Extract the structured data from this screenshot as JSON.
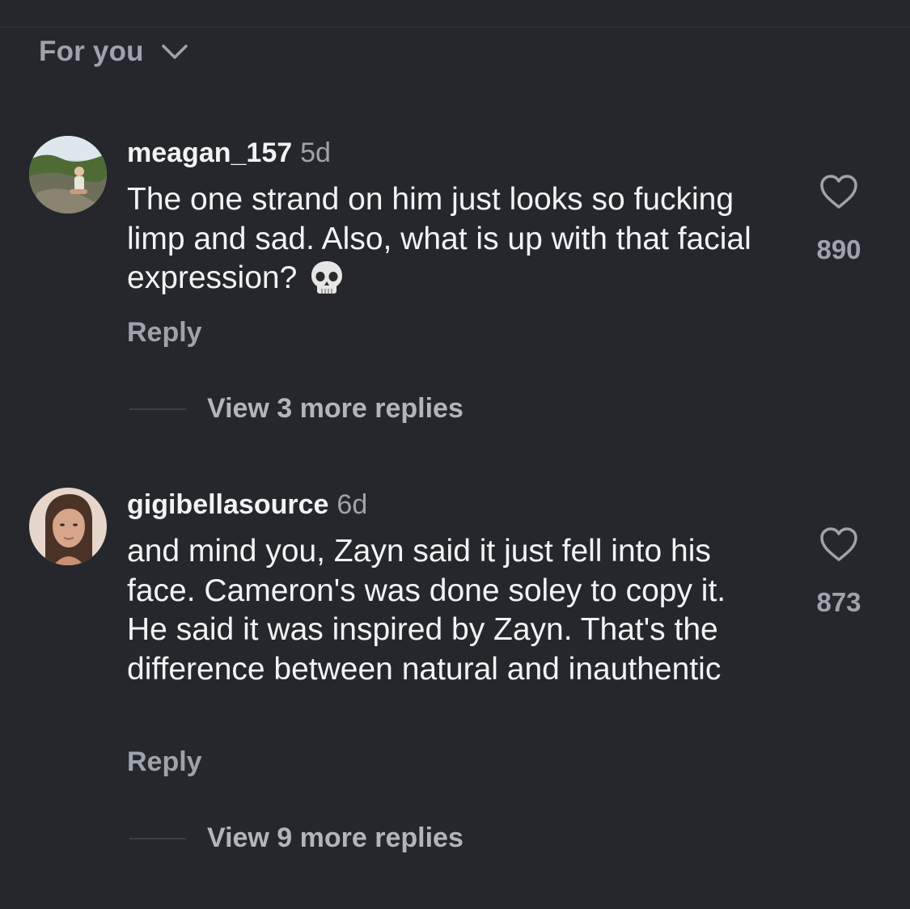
{
  "sort": {
    "label": "For you",
    "icon": "chevron-down-icon"
  },
  "comments": [
    {
      "username": "meagan_157",
      "time": "5d",
      "text": "The one strand on him just looks so fucking limp and sad. Also, what is up with that facial expression?",
      "emoji": "skull-emoji",
      "reply_label": "Reply",
      "view_replies": "View 3 more replies",
      "likes": "890",
      "like_icon": "heart-icon"
    },
    {
      "username": "gigibellasource",
      "time": "6d",
      "text": "and mind you, Zayn said it just fell into his face. Cameron's was done soley to copy it. He said it was inspired by Zayn. That's the difference between natural and inauthentic",
      "reply_label": "Reply",
      "view_replies": "View 9 more replies",
      "likes": "873",
      "like_icon": "heart-icon"
    }
  ],
  "colors": {
    "background": "#25272c",
    "primary_text": "#f2f3f5",
    "secondary_text": "#9ea3ab"
  }
}
